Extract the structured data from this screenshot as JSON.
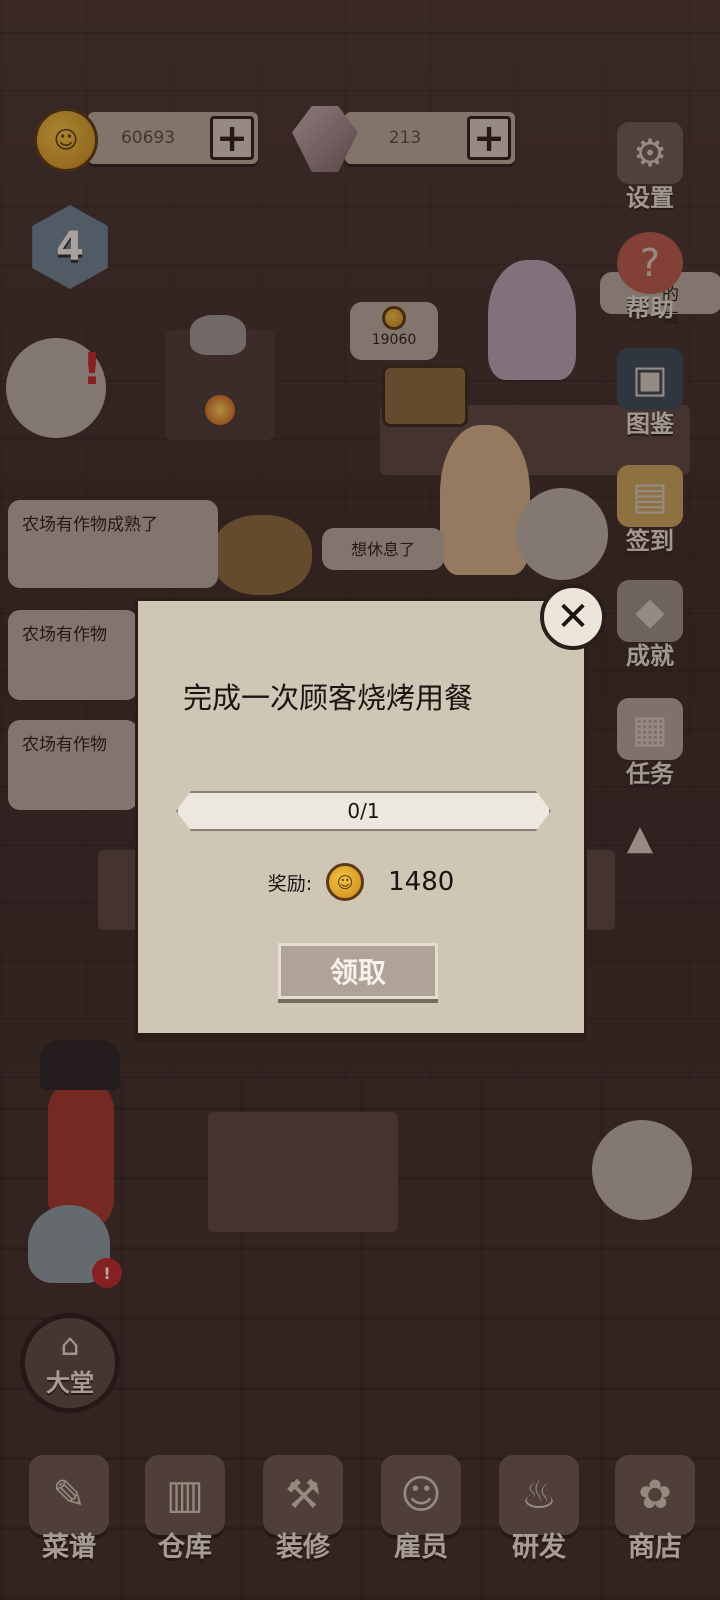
{
  "resources": {
    "coins": "60693",
    "gems": "213",
    "plus_symbol": "+",
    "level": "4"
  },
  "scene": {
    "price_tag": "19060",
    "thought_rest": "想休息了",
    "speech_partial": "的声"
  },
  "notifications": [
    "农场有作物成熟了",
    "农场有作物",
    "农场有作物"
  ],
  "right_menu": [
    {
      "label": "设置",
      "icon": "gear-icon",
      "glyph": "⚙"
    },
    {
      "label": "帮助",
      "icon": "help-icon",
      "glyph": "?"
    },
    {
      "label": "图鉴",
      "icon": "book-icon",
      "glyph": "▣"
    },
    {
      "label": "签到",
      "icon": "calendar-icon",
      "glyph": "▤"
    },
    {
      "label": "成就",
      "icon": "trophy-icon",
      "glyph": "◆"
    },
    {
      "label": "任务",
      "icon": "map-icon",
      "glyph": "▦"
    }
  ],
  "collapse_arrow": "▲",
  "modal": {
    "title": "完成一次顾客烧烤用餐",
    "progress_text": "0/1",
    "progress_fraction": 0,
    "reward_label": "奖励:",
    "reward_value": "1480",
    "claim_label": "领取",
    "close_symbol": "✕"
  },
  "lobby_label": "大堂",
  "bottom_nav": [
    {
      "label": "菜谱",
      "icon": "recipe-icon",
      "glyph": "✎"
    },
    {
      "label": "仓库",
      "icon": "storage-icon",
      "glyph": "▥"
    },
    {
      "label": "装修",
      "icon": "hammer-icon",
      "glyph": "⚒"
    },
    {
      "label": "雇员",
      "icon": "staff-icon",
      "glyph": "☺"
    },
    {
      "label": "研发",
      "icon": "pot-icon",
      "glyph": "♨"
    },
    {
      "label": "商店",
      "icon": "shop-icon",
      "glyph": "✿"
    }
  ],
  "colors": {
    "background": "#3b2b28",
    "modal_bg": "#cfc6b6",
    "button_bg": "#aea396",
    "coin": "#f5c344",
    "alert": "#c0282d"
  }
}
